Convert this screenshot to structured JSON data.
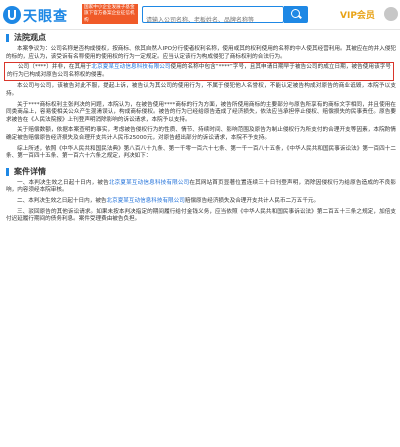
{
  "header": {
    "logo_text": "天眼查",
    "badge_text": "国家中小企业发展子基金旗下官方备案企业征信机构",
    "search_placeholder": "请输入公司名称、老板姓名、品牌名称等",
    "vip_label": "VIP会员"
  },
  "sections": [
    {
      "title": "法院观点"
    },
    {
      "title": "案件详情"
    }
  ],
  "paragraphs": [
    {
      "text": "本案争议为：公司名称是否构成侵权，按商标、依其自然人IPO分行使者权利名称，使用或其的权利使用的名称的中人使其经营利用。其被应在的并入侵犯的标的，应认为，该受诉有名称使用的使用权的行为一定规定。应当认定该行为构成侵犯了商标权利的合法行为。"
    },
    {
      "text": "本公司与公司，该被告对此不服，提起上诉，被告认为其公司的使用行为，不属于侵犯他人名誉权，不能认定被告构成对原告的商业诋毁，本院予以支持。"
    },
    {
      "text": "关于****商标权利主张判决的问题，本院认为，在被告使用****商标的行为方面，被告所使用商标的主要部分与原告所享有的商标文字相同，并且使用在同类商品上，容易使相关公众产生混淆误认，构成商标侵权。被告的行为已经给原告造成了经济损失，依法应当承担停止侵权、赔偿损失的民事责任。原告要求被告在《人民法院报》上刊登声明消除影响的诉讼请求，本院予以支持。"
    },
    {
      "text": "关于赔偿数额，依据本案查明的事实，考虑被告侵权行为的性质、情节、持续时间、影响范围及原告为制止侵权行为所支付的合理开支等因素，本院酌情确定被告赔偿原告经济损失及合理开支共计人民币25000元，对原告超出部分的诉讼请求，本院不予支持。"
    },
    {
      "text": "综上所述，依照《中华人民共和国民法典》第八百八十九条、第一千零一百六十七条、第一千一百八十五条，《中华人民共和国民事诉讼法》第一百四十二条、第一百四十五条、第一百六十六条之规定，判决如下："
    }
  ],
  "highlight": {
    "pre": "公司（****）并非，在其用于",
    "blue": "北京夏某互动信息科技有限公司",
    "post": "使用的名称中包含“****”字号，且其申请日期早于被告公司的成立日期，被告使用该字号的行为已构成对原告公司名称权的侵害。"
  },
  "case_paragraphs": [
    {
      "pre": "一、本判决生效之日起十日内，被告",
      "blue": "北京夏某互动信息科技有限公司",
      "post": "在其网站首页显著位置连续三十日刊登声明，消除因侵权行为给原告造成的不良影响，内容须经本院审核。"
    },
    {
      "pre": "二、本判决生效之日起十日内，被告",
      "blue": "北京夏某互动信息科技有限公司",
      "post": "赔偿原告经济损失及合理开支共计人民币二万五千元。"
    },
    {
      "pre": "三、驳回原告的其他诉讼请求。",
      "blue": "",
      "post": "如果未按本判决指定的期间履行给付金钱义务，应当依照《中华人民共和国民事诉讼法》第二百五十三条之规定，加倍支付迟延履行期间的债务利息。案件受理费由被告负担。"
    }
  ]
}
